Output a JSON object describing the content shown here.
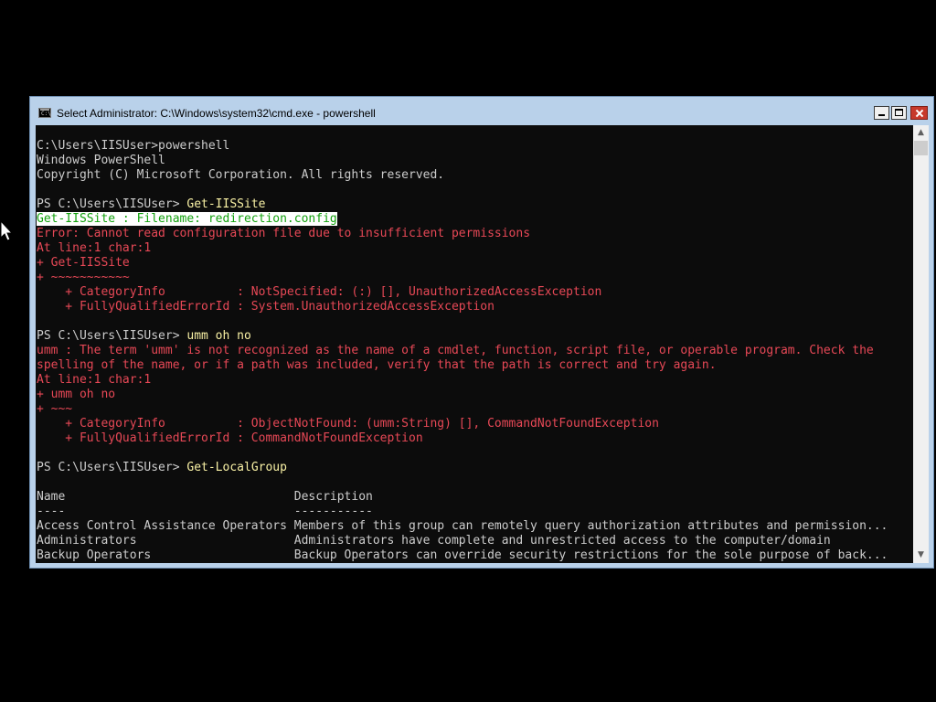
{
  "window": {
    "title": "Select Administrator: C:\\Windows\\system32\\cmd.exe - powershell",
    "icon": "cmd-icon",
    "icon_prompt": "C:\\",
    "controls": [
      "minimize",
      "maximize",
      "close"
    ],
    "accent": "#b9d1ea"
  },
  "colors": {
    "console_bg": "#0c0c0c",
    "default_text": "#cccccc",
    "command_text": "#f9f1a5",
    "error_text": "#e74856",
    "selection_bg": "#ffffff",
    "selection_text": "#13a10e"
  },
  "console": {
    "lines": [
      [
        {
          "t": "C:\\Users\\IISUser>powershell",
          "s": "plain"
        }
      ],
      [
        {
          "t": "Windows PowerShell",
          "s": "plain"
        }
      ],
      [
        {
          "t": "Copyright (C) Microsoft Corporation. All rights reserved.",
          "s": "plain"
        }
      ],
      [
        {
          "t": "",
          "s": "plain"
        }
      ],
      [
        {
          "t": "PS C:\\Users\\IISUser> ",
          "s": "prompt"
        },
        {
          "t": "Get-IISSite",
          "s": "cmd"
        }
      ],
      [
        {
          "t": "Get-IISSite : Filename: redirection.config",
          "s": "hl"
        }
      ],
      [
        {
          "t": "Error: Cannot read configuration file due to insufficient permissions",
          "s": "err"
        }
      ],
      [
        {
          "t": "At line:1 char:1",
          "s": "err"
        }
      ],
      [
        {
          "t": "+ Get-IISSite",
          "s": "err"
        }
      ],
      [
        {
          "t": "+ ~~~~~~~~~~~",
          "s": "err"
        }
      ],
      [
        {
          "t": "    + CategoryInfo          : NotSpecified: (:) [], UnauthorizedAccessException",
          "s": "err"
        }
      ],
      [
        {
          "t": "    + FullyQualifiedErrorId : System.UnauthorizedAccessException",
          "s": "err"
        }
      ],
      [
        {
          "t": "",
          "s": "plain"
        }
      ],
      [
        {
          "t": "PS C:\\Users\\IISUser> ",
          "s": "prompt"
        },
        {
          "t": "umm oh no",
          "s": "cmd"
        }
      ],
      [
        {
          "t": "umm : The term 'umm' is not recognized as the name of a cmdlet, function, script file, or operable program. Check the",
          "s": "err"
        }
      ],
      [
        {
          "t": "spelling of the name, or if a path was included, verify that the path is correct and try again.",
          "s": "err"
        }
      ],
      [
        {
          "t": "At line:1 char:1",
          "s": "err"
        }
      ],
      [
        {
          "t": "+ umm oh no",
          "s": "err"
        }
      ],
      [
        {
          "t": "+ ~~~",
          "s": "err"
        }
      ],
      [
        {
          "t": "    + CategoryInfo          : ObjectNotFound: (umm:String) [], CommandNotFoundException",
          "s": "err"
        }
      ],
      [
        {
          "t": "    + FullyQualifiedErrorId : CommandNotFoundException",
          "s": "err"
        }
      ],
      [
        {
          "t": "",
          "s": "plain"
        }
      ],
      [
        {
          "t": "PS C:\\Users\\IISUser> ",
          "s": "prompt"
        },
        {
          "t": "Get-LocalGroup",
          "s": "cmd"
        }
      ],
      [
        {
          "t": "",
          "s": "plain"
        }
      ],
      [
        {
          "t": "Name                                Description",
          "s": "plain"
        }
      ],
      [
        {
          "t": "----                                -----------",
          "s": "plain"
        }
      ],
      [
        {
          "t": "Access Control Assistance Operators Members of this group can remotely query authorization attributes and permission...",
          "s": "plain"
        }
      ],
      [
        {
          "t": "Administrators                      Administrators have complete and unrestricted access to the computer/domain",
          "s": "plain"
        }
      ],
      [
        {
          "t": "Backup Operators                    Backup Operators can override security restrictions for the sole purpose of back...",
          "s": "plain"
        }
      ]
    ]
  },
  "scrollbar": {
    "up_icon": "chevron-up-icon",
    "down_icon": "chevron-down-icon",
    "up_glyph": "▲",
    "down_glyph": "▼"
  },
  "pointer": {
    "icon": "mouse-pointer-icon"
  }
}
